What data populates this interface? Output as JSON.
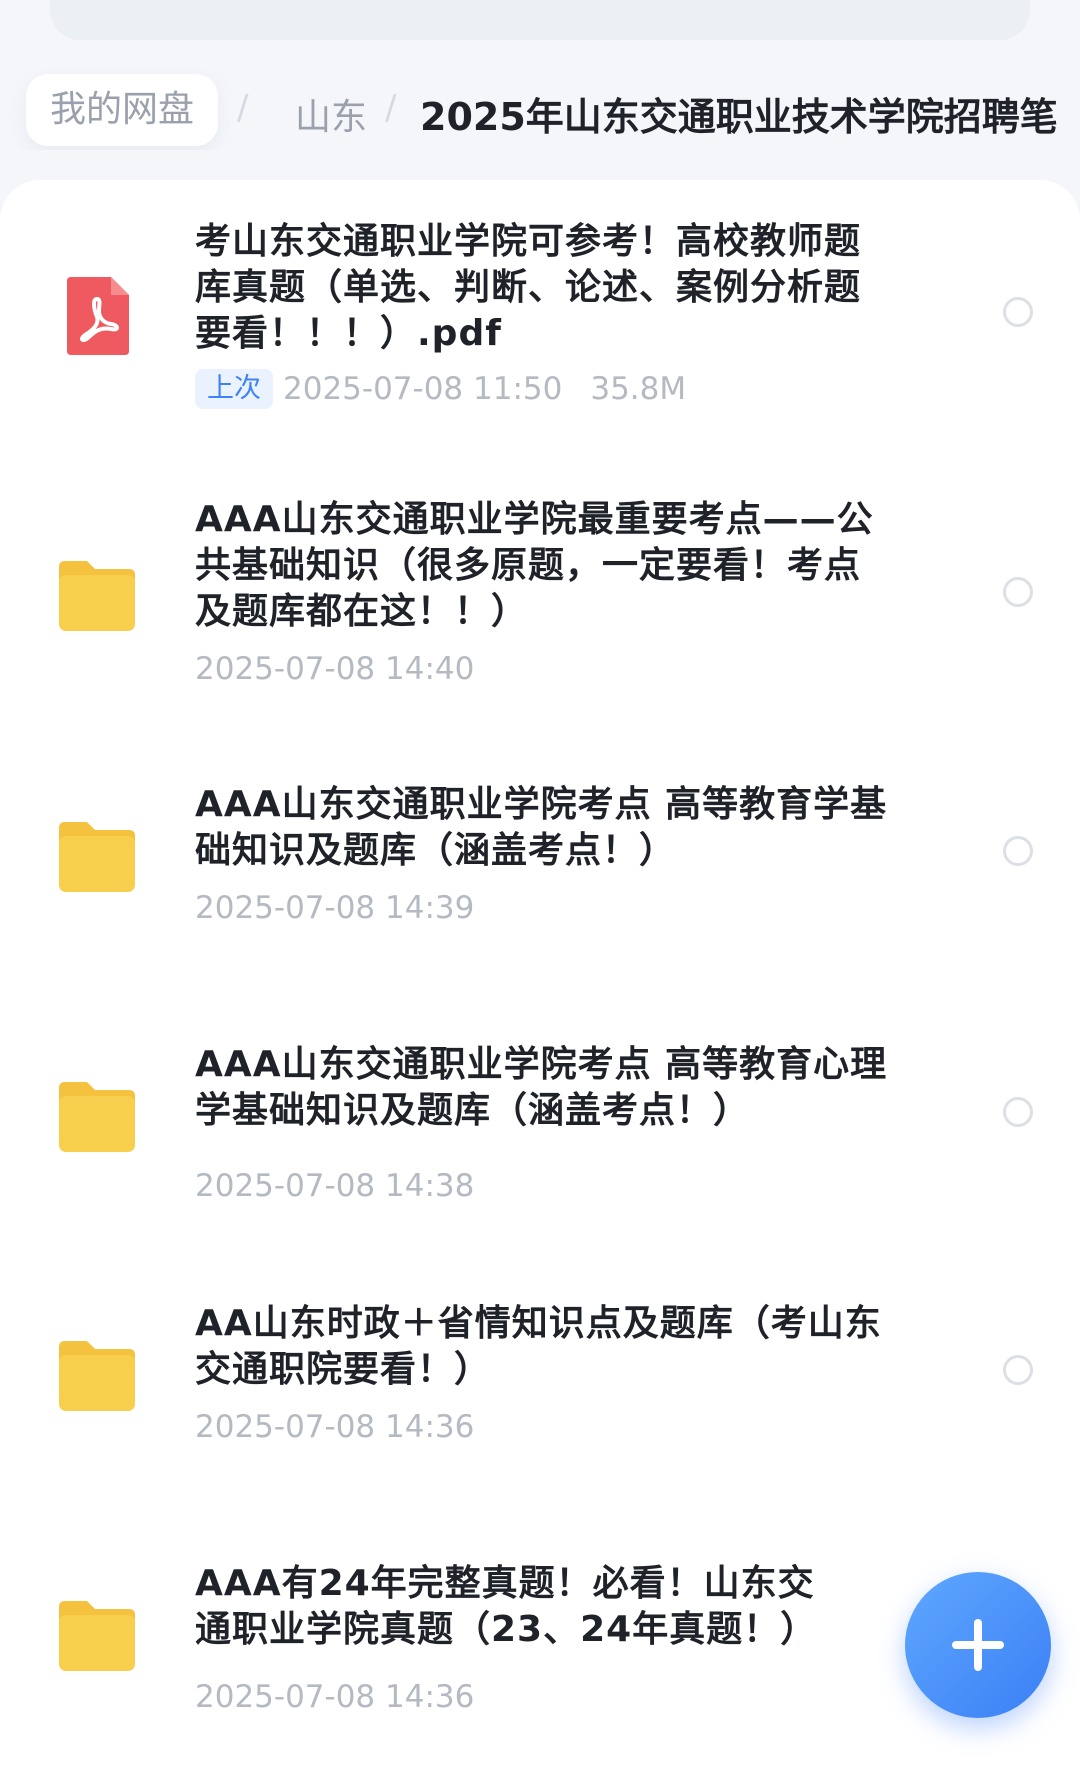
{
  "breadcrumb": {
    "home": "我的网盘",
    "middle": "山东",
    "separator": "/",
    "current": "2025年山东交通职业技术学院招聘笔"
  },
  "files": [
    {
      "type": "pdf",
      "icon": "pdf-icon",
      "name": "考山东交通职业学院可参考！高校教师题库真题（单选、判断、论述、案例分析题要看！！！）.pdf",
      "tag": "上次",
      "date": "2025-07-08 11:50",
      "size": "35.8M"
    },
    {
      "type": "folder",
      "icon": "folder-icon",
      "name": "AAA山东交通职业学院最重要考点——公共基础知识（很多原题，一定要看！考点及题库都在这！！）",
      "date": "2025-07-08 14:40"
    },
    {
      "type": "folder",
      "icon": "folder-icon",
      "name": "AAA山东交通职业学院考点 高等教育学基础知识及题库（涵盖考点！）",
      "date": "2025-07-08 14:39"
    },
    {
      "type": "folder",
      "icon": "folder-icon",
      "name": "AAA山东交通职业学院考点 高等教育心理学基础知识及题库（涵盖考点！）",
      "date": "2025-07-08 14:38"
    },
    {
      "type": "folder",
      "icon": "folder-icon",
      "name": "AA山东时政＋省情知识点及题库（考山东交通职院要看！）",
      "date": "2025-07-08 14:36"
    },
    {
      "type": "folder",
      "icon": "folder-icon",
      "name": "AAA有24年完整真题！必看！山东交通职业学院真题（23、24年真题！）",
      "date": "2025-07-08 14:36"
    }
  ],
  "fab": {
    "icon": "plus-icon"
  },
  "colors": {
    "accent": "#3d82f7",
    "pdf": "#ee5a5f",
    "folder": "#f8cf4d"
  }
}
